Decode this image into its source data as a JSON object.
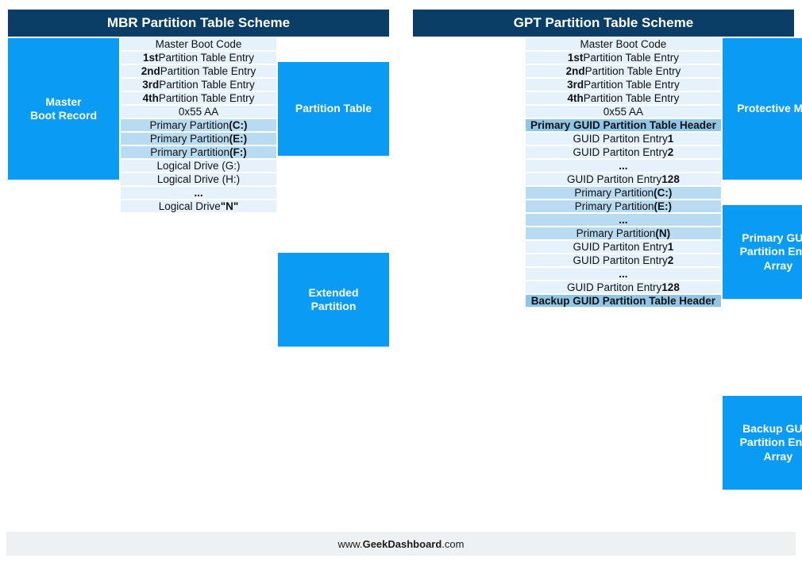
{
  "footer": {
    "pre": "www.",
    "bold": "GeekDashboard",
    "post": ".com"
  },
  "mbr": {
    "title": "MBR Partition Table Scheme",
    "left": {
      "mbr": "Master Boot Record"
    },
    "right": {
      "pt": "Partition Table",
      "ext": "Extended Partition"
    },
    "rows": [
      {
        "html": "Master Boot Code",
        "shade": "light"
      },
      {
        "html": "<b>1st</b> Partition Table Entry",
        "shade": "light"
      },
      {
        "html": "<b>2nd</b> Partition Table Entry",
        "shade": "light"
      },
      {
        "html": "<b>3rd</b> Partition Table Entry",
        "shade": "light"
      },
      {
        "html": "<b>4th</b> Partition Table Entry",
        "shade": "light"
      },
      {
        "html": "0x55 AA",
        "shade": "light"
      },
      {
        "html": "Primary Partition <b>(C:)</b>",
        "shade": "dark"
      },
      {
        "html": "Primary Partition <b>(E:)</b>",
        "shade": "dark"
      },
      {
        "html": "Primary Partition <b>(F:)</b>",
        "shade": "dark"
      },
      {
        "html": "Logical Drive (G:)",
        "shade": "light"
      },
      {
        "html": "Logical Drive (H:)",
        "shade": "light"
      },
      {
        "html": "<b>...</b>",
        "shade": "light"
      },
      {
        "html": "Logical Drive <b>\"N\"</b>",
        "shade": "light"
      }
    ]
  },
  "gpt": {
    "title": "GPT Partition Table Scheme",
    "right": {
      "pmbr": "Protective MBR",
      "pea": "Primary GUID Partition Entry Array",
      "bea": "Backup GUID Partition Entry Array"
    },
    "rows": [
      {
        "html": "Master Boot Code",
        "shade": "light"
      },
      {
        "html": "<b>1st</b> Partition Table Entry",
        "shade": "light"
      },
      {
        "html": "<b>2nd</b> Partition Table Entry",
        "shade": "light"
      },
      {
        "html": "<b>3rd</b> Partition Table Entry",
        "shade": "light"
      },
      {
        "html": "<b>4th</b> Partition Table Entry",
        "shade": "light"
      },
      {
        "html": "0x55 AA",
        "shade": "light"
      },
      {
        "html": "Primary GUID Partition Table Header",
        "shade": "darker"
      },
      {
        "html": "GUID Partiton Entry <b>1</b>",
        "shade": "light"
      },
      {
        "html": "GUID Partiton Entry <b>2</b>",
        "shade": "light"
      },
      {
        "html": "<b>...</b>",
        "shade": "light"
      },
      {
        "html": "GUID Partiton Entry <b>128</b>",
        "shade": "light"
      },
      {
        "html": "Primary Partition <b>(C:)</b>",
        "shade": "dark"
      },
      {
        "html": "Primary Partition <b>(E:)</b>",
        "shade": "dark"
      },
      {
        "html": "<b>...</b>",
        "shade": "dark"
      },
      {
        "html": "Primary Partition <b>(N)</b>",
        "shade": "dark"
      },
      {
        "html": "GUID Partiton Entry <b>1</b>",
        "shade": "light"
      },
      {
        "html": "GUID Partiton Entry <b>2</b>",
        "shade": "light"
      },
      {
        "html": "<b>...</b>",
        "shade": "light"
      },
      {
        "html": "GUID Partiton Entry <b>128</b>",
        "shade": "light"
      },
      {
        "html": "Backup GUID Partition Table Header",
        "shade": "darker"
      }
    ]
  }
}
